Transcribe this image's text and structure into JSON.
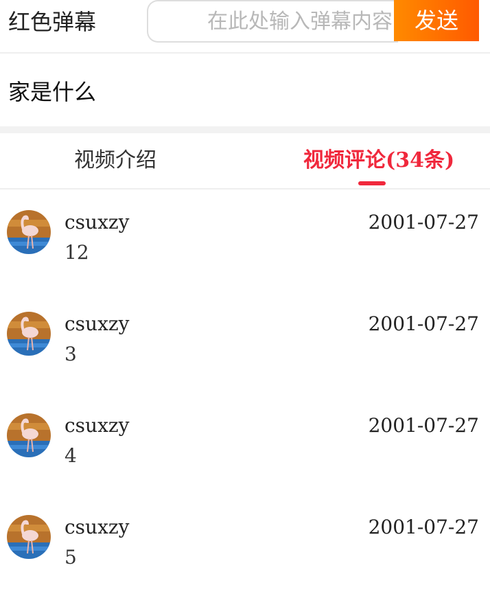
{
  "danmu": {
    "color_label": "红色弹幕",
    "input_placeholder": "在此处输入弹幕内容",
    "input_value": "",
    "send_label": "发送"
  },
  "video": {
    "title": "家是什么"
  },
  "tabs": [
    {
      "label": "视频介绍",
      "active": false
    },
    {
      "label": "视频评论(34条)",
      "active": true
    }
  ],
  "comments": [
    {
      "username": "csuxzy",
      "date": "2001-07-27",
      "content": "12"
    },
    {
      "username": "csuxzy",
      "date": "2001-07-27",
      "content": "3"
    },
    {
      "username": "csuxzy",
      "date": "2001-07-27",
      "content": "4"
    },
    {
      "username": "csuxzy",
      "date": "2001-07-27",
      "content": "5"
    }
  ],
  "colors": {
    "accent_red": "#f0283c",
    "send_button": "#ff6a00"
  },
  "icons": {
    "avatar": "flamingo-avatar-icon"
  }
}
